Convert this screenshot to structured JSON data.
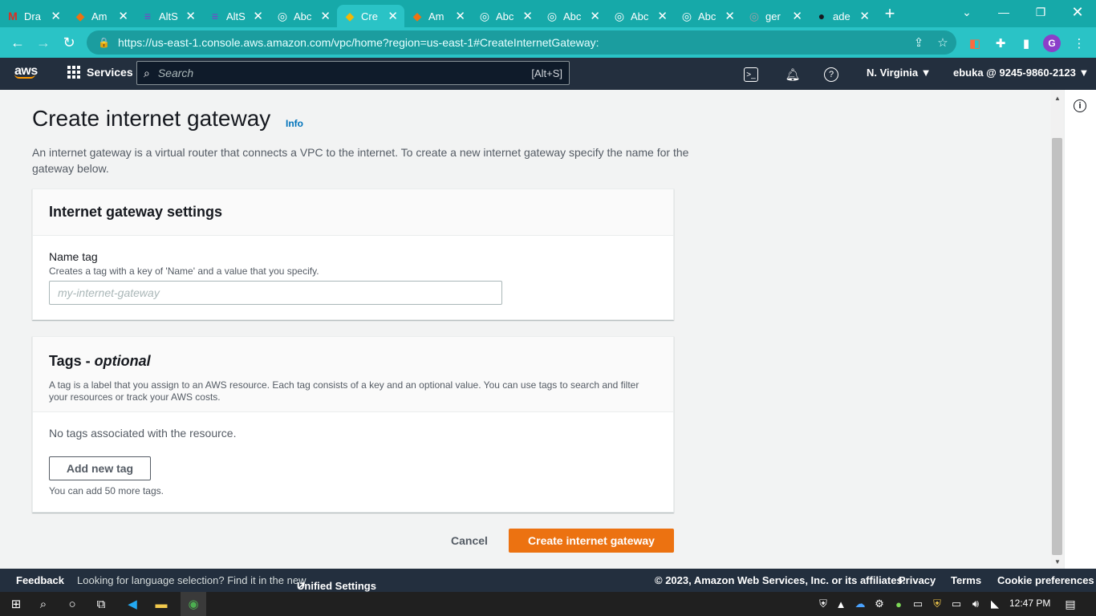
{
  "browser": {
    "tabs": [
      {
        "title": "Dra",
        "icon": "gmail-icon",
        "color": "#d93025",
        "glyph": "M",
        "active": false
      },
      {
        "title": "Am",
        "icon": "aws-cube-icon",
        "color": "#ec7211",
        "glyph": "◆",
        "active": false
      },
      {
        "title": "AltS",
        "icon": "list-icon",
        "color": "#7b3fc9",
        "glyph": "≡",
        "active": false
      },
      {
        "title": "AltS",
        "icon": "list-icon",
        "color": "#7b3fc9",
        "glyph": "≡",
        "active": false
      },
      {
        "title": "Abc",
        "icon": "globe-icon",
        "color": "#ffffff",
        "glyph": "◎",
        "active": false
      },
      {
        "title": "Cre",
        "icon": "aws-cube-icon",
        "color": "#f2b705",
        "glyph": "◆",
        "active": true
      },
      {
        "title": "Am",
        "icon": "aws-cube-icon",
        "color": "#ec7211",
        "glyph": "◆",
        "active": false
      },
      {
        "title": "Abc",
        "icon": "globe-icon",
        "color": "#ffffff",
        "glyph": "◎",
        "active": false
      },
      {
        "title": "Abc",
        "icon": "globe-icon",
        "color": "#ffffff",
        "glyph": "◎",
        "active": false
      },
      {
        "title": "Abc",
        "icon": "globe-icon",
        "color": "#ffffff",
        "glyph": "◎",
        "active": false
      },
      {
        "title": "Abc",
        "icon": "globe-icon",
        "color": "#ffffff",
        "glyph": "◎",
        "active": false
      },
      {
        "title": "ger",
        "icon": "globe-icon",
        "color": "#9aa0a6",
        "glyph": "◎",
        "active": false
      },
      {
        "title": "ade",
        "icon": "github-icon",
        "color": "#16191f",
        "glyph": "●",
        "active": false
      }
    ],
    "url": "https://us-east-1.console.aws.amazon.com/vpc/home?region=us-east-1#CreateInternetGateway:",
    "profile_initial": "G"
  },
  "aws_header": {
    "logo": "aws",
    "services_label": "Services",
    "search_placeholder": "Search",
    "search_shortcut": "[Alt+S]",
    "region": "N. Virginia ▼",
    "account": "ebuka @ 9245-9860-2123 ▼"
  },
  "page": {
    "title": "Create internet gateway",
    "info_link": "Info",
    "description": "An internet gateway is a virtual router that connects a VPC to the internet. To create a new internet gateway specify the name for the gateway below."
  },
  "settings_panel": {
    "heading": "Internet gateway settings",
    "name_label": "Name tag",
    "name_description": "Creates a tag with a key of 'Name' and a value that you specify.",
    "name_placeholder": "my-internet-gateway",
    "name_value": ""
  },
  "tags_panel": {
    "heading": "Tags - ",
    "heading_optional": "optional",
    "description": "A tag is a label that you assign to an AWS resource. Each tag consists of a key and an optional value. You can use tags to search and filter your resources or track your AWS costs.",
    "empty_text": "No tags associated with the resource.",
    "add_button": "Add new tag",
    "remaining_text": "You can add 50 more tags."
  },
  "actions": {
    "cancel": "Cancel",
    "create": "Create internet gateway"
  },
  "footer": {
    "feedback": "Feedback",
    "language_prompt": "Looking for language selection? Find it in the new",
    "unified_settings": "Unified Settings",
    "copyright": "© 2023, Amazon Web Services, Inc. or its affiliates.",
    "privacy": "Privacy",
    "terms": "Terms",
    "cookie": "Cookie preferences"
  },
  "taskbar": {
    "time": "12:47 PM"
  },
  "colors": {
    "tab_strip": "#16a9a9",
    "address_bar": "#2ac3c6",
    "aws_nav": "#232f3e",
    "primary_button": "#ec7211",
    "link": "#0073bb"
  }
}
